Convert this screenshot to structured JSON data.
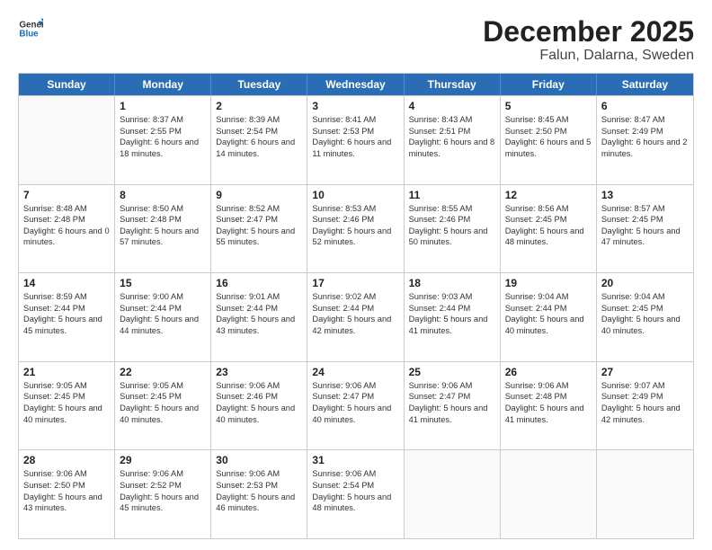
{
  "logo": {
    "line1": "General",
    "line2": "Blue"
  },
  "title": "December 2025",
  "location": "Falun, Dalarna, Sweden",
  "header_days": [
    "Sunday",
    "Monday",
    "Tuesday",
    "Wednesday",
    "Thursday",
    "Friday",
    "Saturday"
  ],
  "weeks": [
    [
      {
        "day": "",
        "sunrise": "",
        "sunset": "",
        "daylight": ""
      },
      {
        "day": "1",
        "sunrise": "Sunrise: 8:37 AM",
        "sunset": "Sunset: 2:55 PM",
        "daylight": "Daylight: 6 hours and 18 minutes."
      },
      {
        "day": "2",
        "sunrise": "Sunrise: 8:39 AM",
        "sunset": "Sunset: 2:54 PM",
        "daylight": "Daylight: 6 hours and 14 minutes."
      },
      {
        "day": "3",
        "sunrise": "Sunrise: 8:41 AM",
        "sunset": "Sunset: 2:53 PM",
        "daylight": "Daylight: 6 hours and 11 minutes."
      },
      {
        "day": "4",
        "sunrise": "Sunrise: 8:43 AM",
        "sunset": "Sunset: 2:51 PM",
        "daylight": "Daylight: 6 hours and 8 minutes."
      },
      {
        "day": "5",
        "sunrise": "Sunrise: 8:45 AM",
        "sunset": "Sunset: 2:50 PM",
        "daylight": "Daylight: 6 hours and 5 minutes."
      },
      {
        "day": "6",
        "sunrise": "Sunrise: 8:47 AM",
        "sunset": "Sunset: 2:49 PM",
        "daylight": "Daylight: 6 hours and 2 minutes."
      }
    ],
    [
      {
        "day": "7",
        "sunrise": "Sunrise: 8:48 AM",
        "sunset": "Sunset: 2:48 PM",
        "daylight": "Daylight: 6 hours and 0 minutes."
      },
      {
        "day": "8",
        "sunrise": "Sunrise: 8:50 AM",
        "sunset": "Sunset: 2:48 PM",
        "daylight": "Daylight: 5 hours and 57 minutes."
      },
      {
        "day": "9",
        "sunrise": "Sunrise: 8:52 AM",
        "sunset": "Sunset: 2:47 PM",
        "daylight": "Daylight: 5 hours and 55 minutes."
      },
      {
        "day": "10",
        "sunrise": "Sunrise: 8:53 AM",
        "sunset": "Sunset: 2:46 PM",
        "daylight": "Daylight: 5 hours and 52 minutes."
      },
      {
        "day": "11",
        "sunrise": "Sunrise: 8:55 AM",
        "sunset": "Sunset: 2:46 PM",
        "daylight": "Daylight: 5 hours and 50 minutes."
      },
      {
        "day": "12",
        "sunrise": "Sunrise: 8:56 AM",
        "sunset": "Sunset: 2:45 PM",
        "daylight": "Daylight: 5 hours and 48 minutes."
      },
      {
        "day": "13",
        "sunrise": "Sunrise: 8:57 AM",
        "sunset": "Sunset: 2:45 PM",
        "daylight": "Daylight: 5 hours and 47 minutes."
      }
    ],
    [
      {
        "day": "14",
        "sunrise": "Sunrise: 8:59 AM",
        "sunset": "Sunset: 2:44 PM",
        "daylight": "Daylight: 5 hours and 45 minutes."
      },
      {
        "day": "15",
        "sunrise": "Sunrise: 9:00 AM",
        "sunset": "Sunset: 2:44 PM",
        "daylight": "Daylight: 5 hours and 44 minutes."
      },
      {
        "day": "16",
        "sunrise": "Sunrise: 9:01 AM",
        "sunset": "Sunset: 2:44 PM",
        "daylight": "Daylight: 5 hours and 43 minutes."
      },
      {
        "day": "17",
        "sunrise": "Sunrise: 9:02 AM",
        "sunset": "Sunset: 2:44 PM",
        "daylight": "Daylight: 5 hours and 42 minutes."
      },
      {
        "day": "18",
        "sunrise": "Sunrise: 9:03 AM",
        "sunset": "Sunset: 2:44 PM",
        "daylight": "Daylight: 5 hours and 41 minutes."
      },
      {
        "day": "19",
        "sunrise": "Sunrise: 9:04 AM",
        "sunset": "Sunset: 2:44 PM",
        "daylight": "Daylight: 5 hours and 40 minutes."
      },
      {
        "day": "20",
        "sunrise": "Sunrise: 9:04 AM",
        "sunset": "Sunset: 2:45 PM",
        "daylight": "Daylight: 5 hours and 40 minutes."
      }
    ],
    [
      {
        "day": "21",
        "sunrise": "Sunrise: 9:05 AM",
        "sunset": "Sunset: 2:45 PM",
        "daylight": "Daylight: 5 hours and 40 minutes."
      },
      {
        "day": "22",
        "sunrise": "Sunrise: 9:05 AM",
        "sunset": "Sunset: 2:45 PM",
        "daylight": "Daylight: 5 hours and 40 minutes."
      },
      {
        "day": "23",
        "sunrise": "Sunrise: 9:06 AM",
        "sunset": "Sunset: 2:46 PM",
        "daylight": "Daylight: 5 hours and 40 minutes."
      },
      {
        "day": "24",
        "sunrise": "Sunrise: 9:06 AM",
        "sunset": "Sunset: 2:47 PM",
        "daylight": "Daylight: 5 hours and 40 minutes."
      },
      {
        "day": "25",
        "sunrise": "Sunrise: 9:06 AM",
        "sunset": "Sunset: 2:47 PM",
        "daylight": "Daylight: 5 hours and 41 minutes."
      },
      {
        "day": "26",
        "sunrise": "Sunrise: 9:06 AM",
        "sunset": "Sunset: 2:48 PM",
        "daylight": "Daylight: 5 hours and 41 minutes."
      },
      {
        "day": "27",
        "sunrise": "Sunrise: 9:07 AM",
        "sunset": "Sunset: 2:49 PM",
        "daylight": "Daylight: 5 hours and 42 minutes."
      }
    ],
    [
      {
        "day": "28",
        "sunrise": "Sunrise: 9:06 AM",
        "sunset": "Sunset: 2:50 PM",
        "daylight": "Daylight: 5 hours and 43 minutes."
      },
      {
        "day": "29",
        "sunrise": "Sunrise: 9:06 AM",
        "sunset": "Sunset: 2:52 PM",
        "daylight": "Daylight: 5 hours and 45 minutes."
      },
      {
        "day": "30",
        "sunrise": "Sunrise: 9:06 AM",
        "sunset": "Sunset: 2:53 PM",
        "daylight": "Daylight: 5 hours and 46 minutes."
      },
      {
        "day": "31",
        "sunrise": "Sunrise: 9:06 AM",
        "sunset": "Sunset: 2:54 PM",
        "daylight": "Daylight: 5 hours and 48 minutes."
      },
      {
        "day": "",
        "sunrise": "",
        "sunset": "",
        "daylight": ""
      },
      {
        "day": "",
        "sunrise": "",
        "sunset": "",
        "daylight": ""
      },
      {
        "day": "",
        "sunrise": "",
        "sunset": "",
        "daylight": ""
      }
    ]
  ]
}
